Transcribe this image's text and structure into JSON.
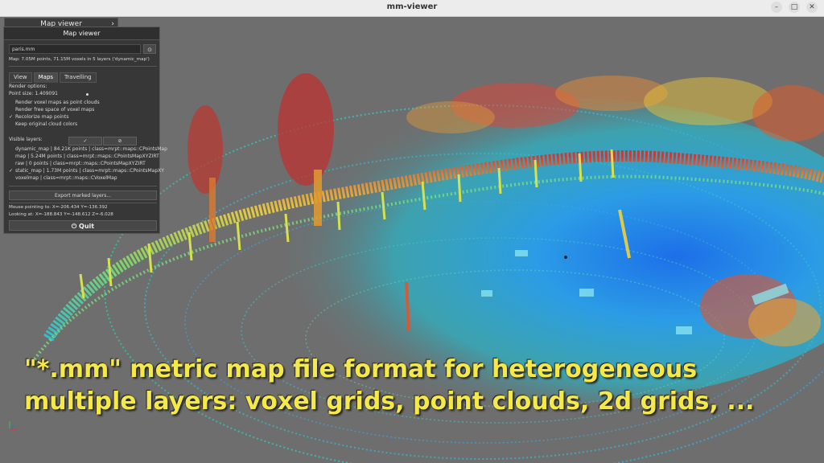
{
  "window": {
    "title": "mm-viewer",
    "minimize": "–",
    "maximize": "□",
    "close": "✕"
  },
  "panel_collapsed": {
    "title": "Map viewer",
    "chevron": "›"
  },
  "panel": {
    "title": "Map viewer",
    "file_field": "paris.mm",
    "camera_icon": "camera-icon",
    "camera_glyph": "⊙",
    "map_info": "Map: 7.05M points, 71.15M voxels in 5 layers ('dynamic_map')",
    "tabs": [
      "View",
      "Maps",
      "Travelling"
    ],
    "active_tab": "Maps",
    "render_options_label": "Render options:",
    "point_size_label": "Point size: 1.409091",
    "options": [
      {
        "label": "Render voxel maps as point clouds",
        "checked": false
      },
      {
        "label": "Render free space of voxel maps",
        "checked": false
      },
      {
        "label": "Recolorize map points",
        "checked": true
      },
      {
        "label": "Keep original cloud colors",
        "checked": false
      }
    ],
    "visible_layers_label": "Visible layers:",
    "check_all_btn": "✓",
    "uncheck_all_btn": "⊘",
    "layers": [
      {
        "label": "dynamic_map | 84.21K points | class=mrpt::maps::CPointsMap",
        "checked": false
      },
      {
        "label": "map | 5.24M points | class=mrpt::maps::CPointsMapXYZIRT",
        "checked": false
      },
      {
        "label": "raw | 0 points | class=mrpt::maps::CPointsMapXYZIRT",
        "checked": false
      },
      {
        "label": "static_map | 1.73M points | class=mrpt::maps::CPointsMapXY",
        "checked": true
      },
      {
        "label": "voxelmap | class=mrpt::maps::CVoxelMap",
        "checked": false
      }
    ],
    "check_glyph": "✓",
    "export_btn": "Export marked layers...",
    "mouse_pointing": "Mouse pointing to: X=-206.434 Y=-136.392",
    "looking_at": "Looking at: X=-188.843 Y=-148.612 Z=-6.028",
    "quit_btn": "⏻ Quit"
  },
  "caption": {
    "line1": "\"*.mm\" metric map file format for heterogeneous",
    "line2": "multiple layers: voxel grids, point clouds, 2d grids, ..."
  }
}
